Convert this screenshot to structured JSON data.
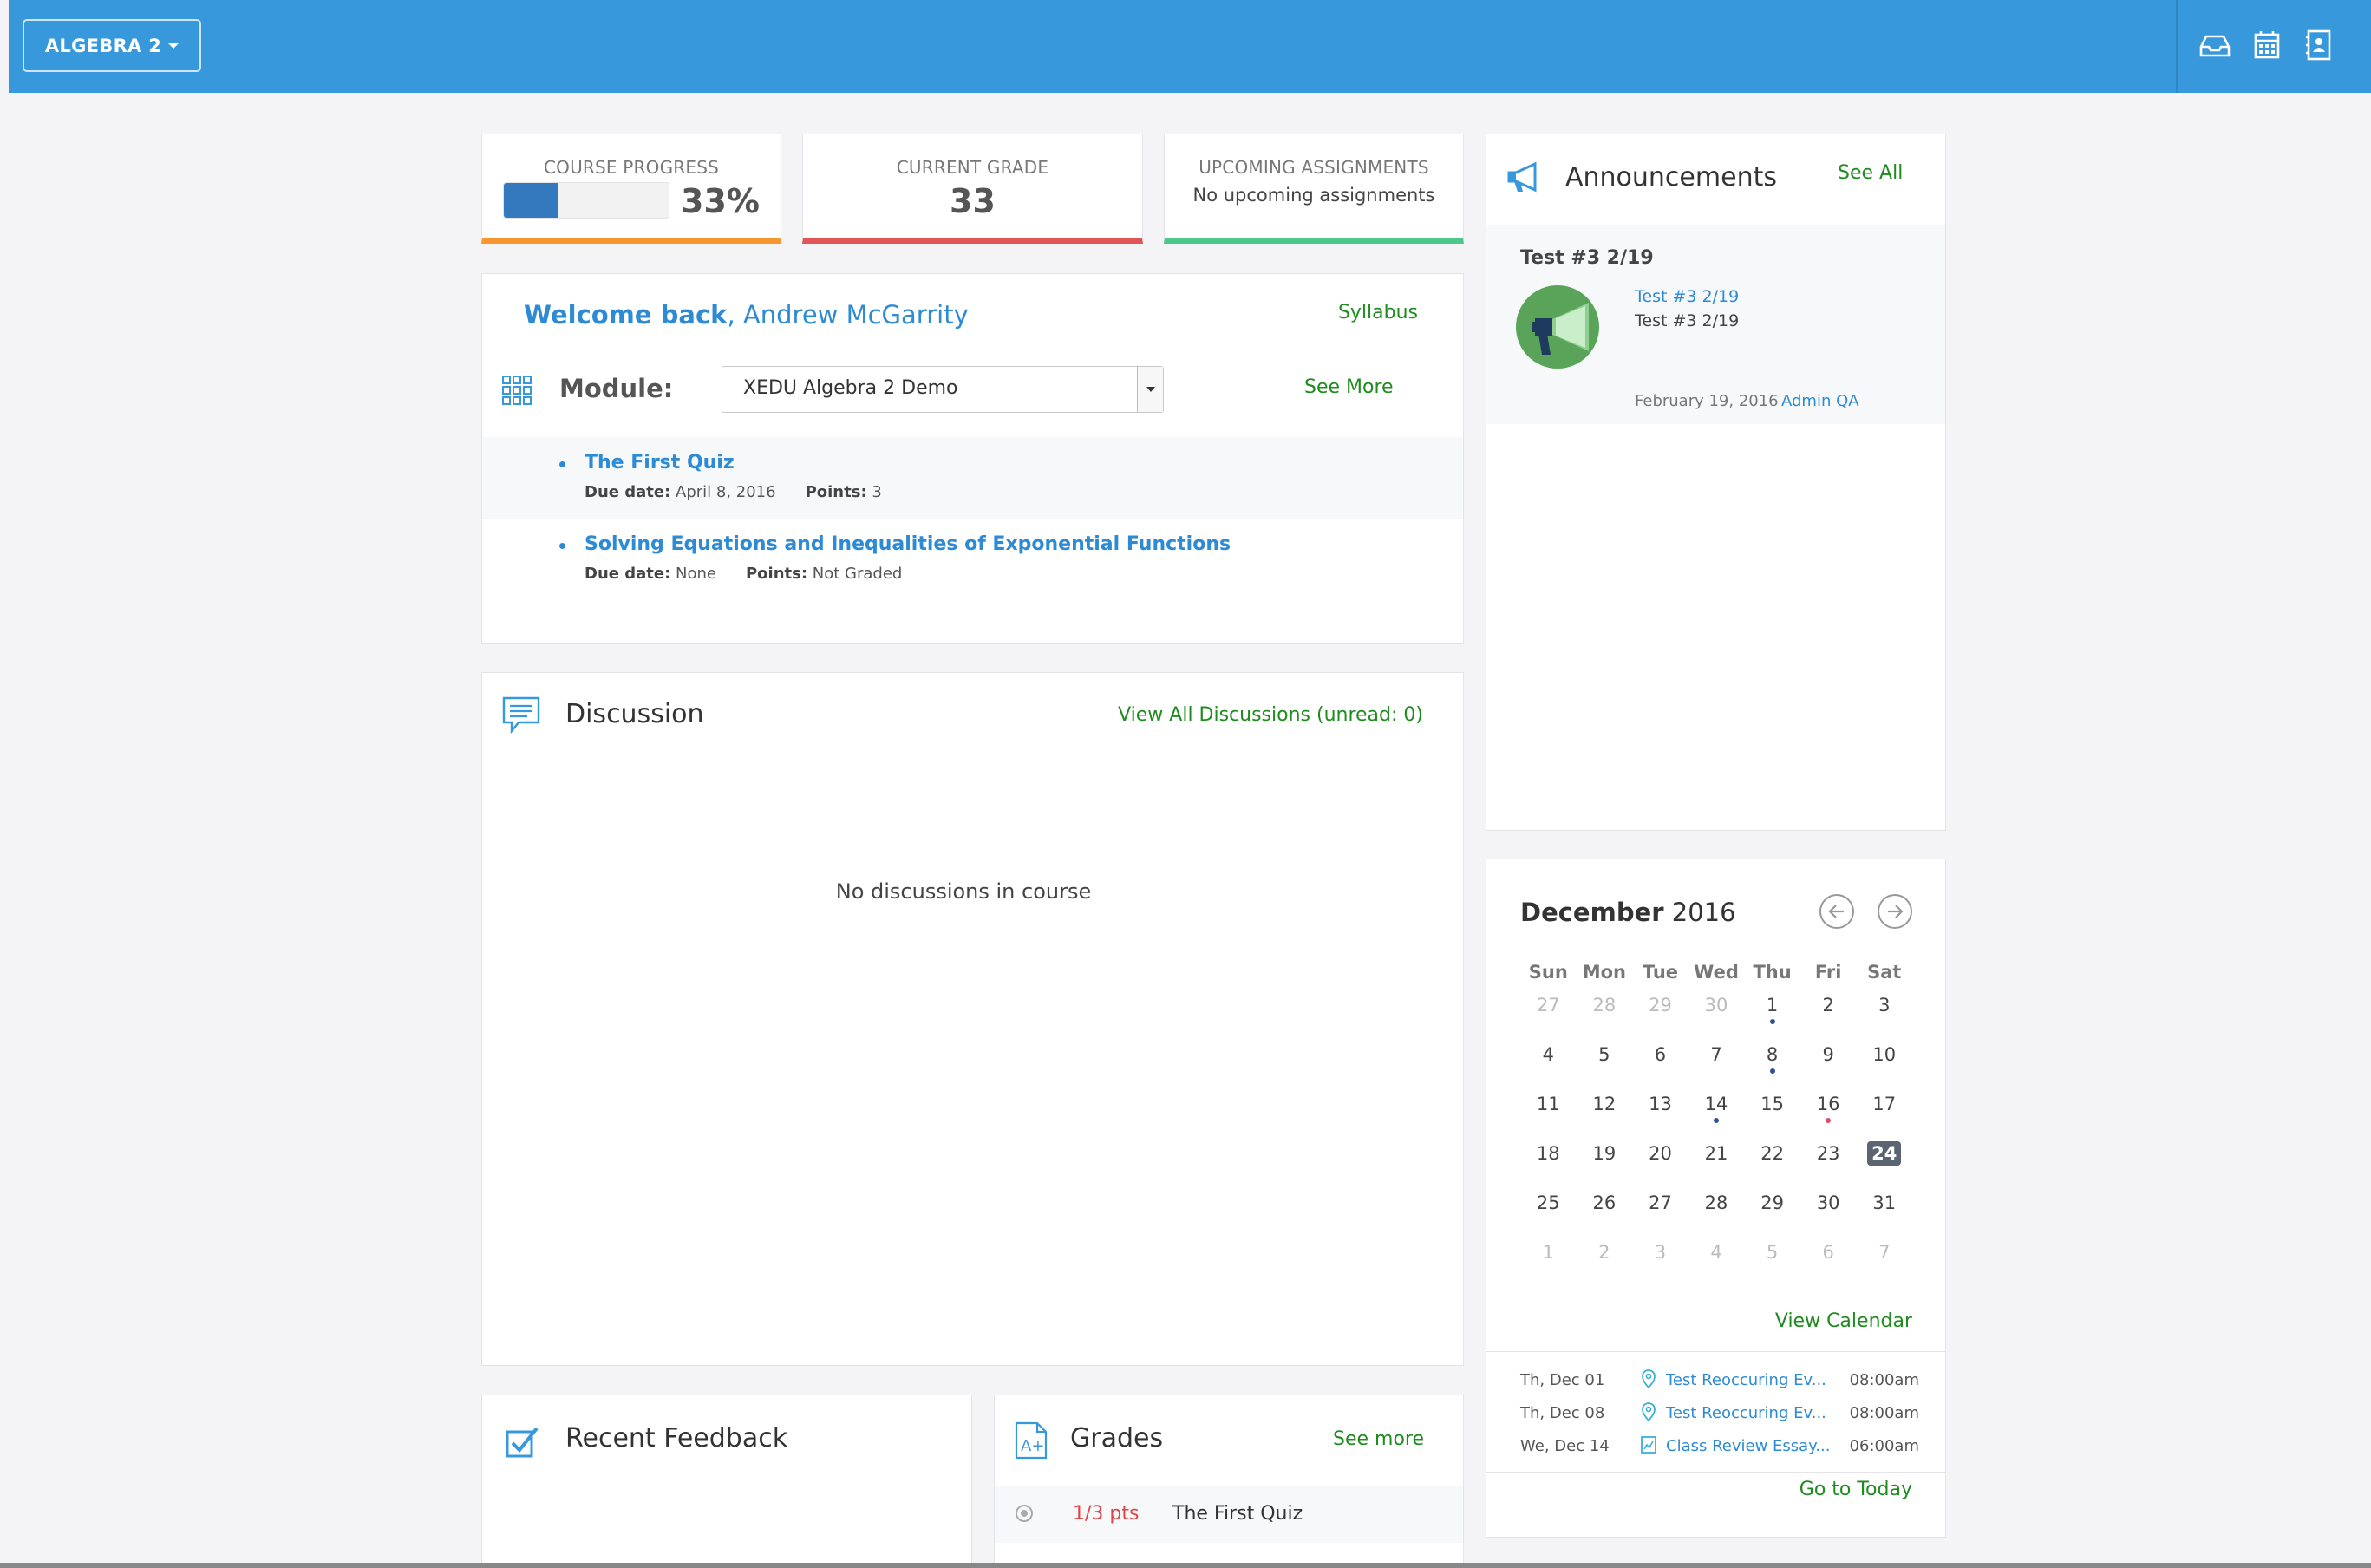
{
  "header": {
    "course_button": "ALGEBRA 2",
    "icons": [
      "inbox-icon",
      "calendar-icon",
      "address-book-icon"
    ],
    "brand_color": "#3898dc"
  },
  "stats": {
    "progress": {
      "title": "COURSE PROGRESS",
      "value": "33%",
      "fraction": 0.33
    },
    "grade": {
      "title": "CURRENT GRADE",
      "value": "33"
    },
    "upcoming": {
      "title": "UPCOMING ASSIGNMENTS",
      "text": "No upcoming assignments"
    }
  },
  "welcome": {
    "greeting": "Welcome back",
    "name": ", Andrew McGarrity",
    "syllabus": "Syllabus",
    "module_label": "Module:",
    "module_selected": "XEDU Algebra 2 Demo",
    "see_more": "See More",
    "assignments": [
      {
        "title": "The First Quiz",
        "due_label": "Due date:",
        "due": " April 8, 2016",
        "points_label": "Points:",
        "points": " 3"
      },
      {
        "title": "Solving Equations and Inequalities of Exponential Functions",
        "due_label": "Due date:",
        "due": " None",
        "points_label": "Points:",
        "points": " Not Graded"
      }
    ]
  },
  "discussion": {
    "title": "Discussion",
    "view_all": "View All Discussions (unread: 0)",
    "empty": "No discussions in course"
  },
  "feedback": {
    "title": "Recent Feedback"
  },
  "grades": {
    "title": "Grades",
    "see_more": "See more",
    "rows": [
      {
        "points": "1/3 pts",
        "name": "The First Quiz"
      }
    ]
  },
  "announcements": {
    "title": "Announcements",
    "see_all": "See All",
    "items": [
      {
        "heading": "Test #3 2/19",
        "link": "Test #3 2/19",
        "text": "Test #3 2/19",
        "date": "February 19, 2016",
        "author": "Admin QA"
      }
    ]
  },
  "calendar": {
    "month": "December",
    "year": " 2016",
    "weekdays": [
      "Sun",
      "Mon",
      "Tue",
      "Wed",
      "Thu",
      "Fri",
      "Sat"
    ],
    "weeks": [
      [
        {
          "d": "27",
          "m": true
        },
        {
          "d": "28",
          "m": true
        },
        {
          "d": "29",
          "m": true
        },
        {
          "d": "30",
          "m": true
        },
        {
          "d": "1",
          "dot": "blue"
        },
        {
          "d": "2"
        },
        {
          "d": "3"
        }
      ],
      [
        {
          "d": "4"
        },
        {
          "d": "5"
        },
        {
          "d": "6"
        },
        {
          "d": "7"
        },
        {
          "d": "8",
          "dot": "blue"
        },
        {
          "d": "9"
        },
        {
          "d": "10"
        }
      ],
      [
        {
          "d": "11"
        },
        {
          "d": "12"
        },
        {
          "d": "13"
        },
        {
          "d": "14",
          "dot": "blue"
        },
        {
          "d": "15"
        },
        {
          "d": "16",
          "dot": "red"
        },
        {
          "d": "17"
        }
      ],
      [
        {
          "d": "18"
        },
        {
          "d": "19"
        },
        {
          "d": "20"
        },
        {
          "d": "21"
        },
        {
          "d": "22"
        },
        {
          "d": "23"
        },
        {
          "d": "24",
          "today": true
        }
      ],
      [
        {
          "d": "25"
        },
        {
          "d": "26"
        },
        {
          "d": "27"
        },
        {
          "d": "28"
        },
        {
          "d": "29"
        },
        {
          "d": "30"
        },
        {
          "d": "31"
        }
      ],
      [
        {
          "d": "1",
          "m": true
        },
        {
          "d": "2",
          "m": true
        },
        {
          "d": "3",
          "m": true
        },
        {
          "d": "4",
          "m": true
        },
        {
          "d": "5",
          "m": true
        },
        {
          "d": "6",
          "m": true
        },
        {
          "d": "7",
          "m": true
        }
      ]
    ],
    "view_calendar": "View Calendar",
    "events": [
      {
        "date": "Th, Dec 01",
        "icon": "location-pin-icon",
        "title": "Test Reoccuring Ev...",
        "time": "08:00am"
      },
      {
        "date": "Th, Dec 08",
        "icon": "location-pin-icon",
        "title": "Test Reoccuring Ev...",
        "time": "08:00am"
      },
      {
        "date": "We, Dec 14",
        "icon": "document-chart-icon",
        "title": "Class Review Essay...",
        "time": "06:00am"
      }
    ],
    "go_today": "Go to Today"
  }
}
